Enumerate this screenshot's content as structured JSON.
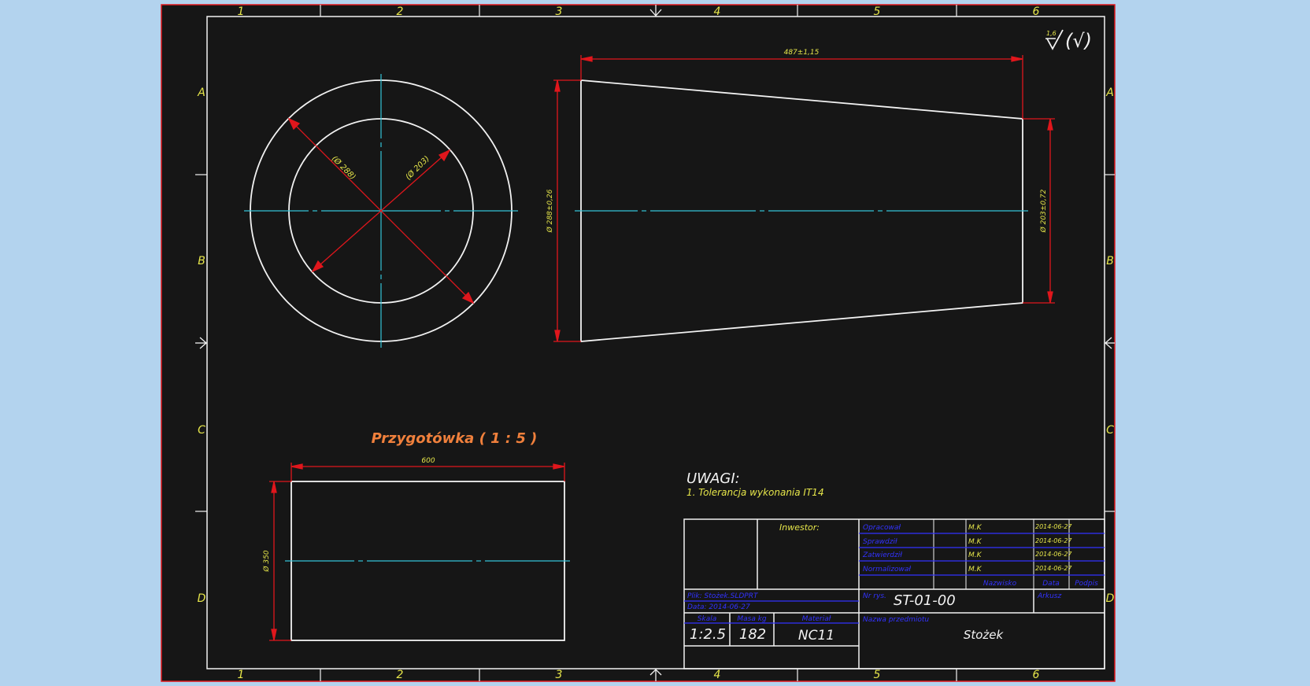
{
  "colors": {
    "page_bg": "#b3d3ee",
    "sheet_bg": "#161616",
    "line": "#f2f2f2",
    "dim": "#e0161c",
    "dim_text": "#e6e64a",
    "center": "#33c4d8",
    "title_orange": "#f0803c",
    "tb_blue": "#3232ff",
    "sheet_edge": "#e0161c"
  },
  "zones": {
    "cols": [
      "1",
      "2",
      "3",
      "4",
      "5",
      "6"
    ],
    "rows": [
      "A",
      "B",
      "C",
      "D"
    ]
  },
  "surface_mark": {
    "value": "1,6",
    "symbol": "√",
    "paren": "(√)"
  },
  "front_view": {
    "outer_dia_label": "(Ø 288)",
    "inner_dia_label": "(Ø 203)"
  },
  "side_view": {
    "length_label": "487±1,15",
    "left_dia_label": "Ø 288±0,26",
    "right_dia_label": "Ø 203±0,72"
  },
  "blank": {
    "title": "Przygotówka ( 1 : 5 )",
    "length_label": "600",
    "dia_label": "Ø 350"
  },
  "notes": {
    "heading": "UWAGI:",
    "items": [
      "1. Tolerancja wykonania IT14"
    ]
  },
  "title_block": {
    "investor_label": "Inwestor:",
    "roles": [
      {
        "role": "Opracował",
        "name": "M.K",
        "date": "2014-06-27"
      },
      {
        "role": "Sprawdził",
        "name": "M.K",
        "date": "2014-06-27"
      },
      {
        "role": "Zatwierdził",
        "name": "M.K",
        "date": "2014-06-27"
      },
      {
        "role": "Normalizował",
        "name": "M.K",
        "date": "2014-06-27"
      }
    ],
    "col_headers": {
      "name": "Nazwisko",
      "date": "Data",
      "sign": "Podpis"
    },
    "meta_left": [
      "Plik: Stożek.SLDPRT",
      "Data: 2014-06-27"
    ],
    "drawing_no_label": "Nr rys.",
    "drawing_no": "ST-01-00",
    "sheet_label": "Arkusz",
    "scale_label": "Skala",
    "scale": "1:2.5",
    "mass_label": "Masa kg",
    "mass": "182",
    "material_label": "Materiał",
    "material": "NC11",
    "part_name_label": "Nazwa przedmiotu",
    "part_name": "Stożek"
  }
}
